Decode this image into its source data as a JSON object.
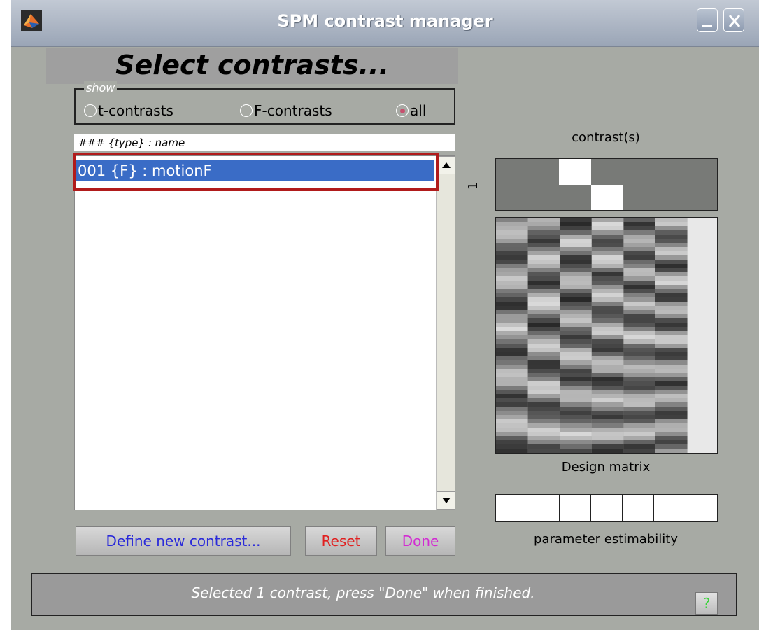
{
  "window": {
    "title": "SPM contrast manager",
    "app_icon": "matlab-logo-icon",
    "controls": [
      "minimize-icon",
      "close-icon"
    ]
  },
  "heading": "Select contrasts...",
  "show": {
    "legend": "show",
    "options": [
      {
        "label": "t-contrasts",
        "selected": false
      },
      {
        "label": "F-contrasts",
        "selected": false
      },
      {
        "label": "all",
        "selected": true
      }
    ]
  },
  "list": {
    "header": "### {type} : name",
    "items": [
      {
        "label": "001 {F} : motionF",
        "selected": true
      }
    ]
  },
  "buttons": {
    "define": "Define new contrast...",
    "reset": "Reset",
    "done": "Done"
  },
  "right_panel": {
    "contrast_label": "contrast(s)",
    "contrast_row_label": "1",
    "design_label": "Design matrix",
    "estimability_label": "parameter estimability",
    "estimability_columns": 7
  },
  "status": {
    "text": "Selected 1 contrast, press \"Done\" when finished.",
    "help_label": "?"
  },
  "colors": {
    "window_bg": "#a7aaa4",
    "selection": "#3a6cc6",
    "highlight_outline": "#b11b1b",
    "define_text": "#2b2bd9",
    "reset_text": "#e02020",
    "done_text": "#d22cd2",
    "help_text": "#3bd23b"
  }
}
